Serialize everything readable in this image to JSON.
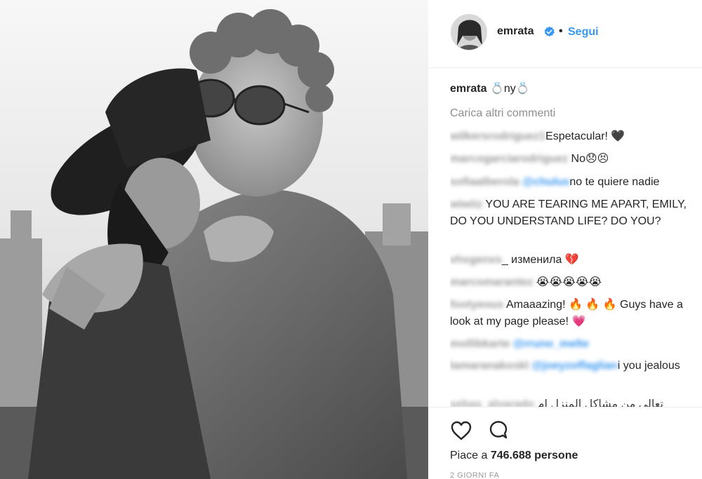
{
  "post": {
    "photo": {
      "alt": ""
    }
  },
  "header": {
    "username": "emrata",
    "separator": "•",
    "follow_label": "Segui",
    "verified_icon": "verified-badge-icon"
  },
  "caption": {
    "username": "emrata",
    "text": "💍ny💍"
  },
  "load_more_label": "Carica altri commenti",
  "comments": [
    {
      "user": "wilkersrodriguez1",
      "text": "Espetacular! 🖤"
    },
    {
      "user": "marcogarciarodriguez",
      "text": "No😞😣"
    },
    {
      "user": "sofiaalberola",
      "mention": "@chulus",
      "text": "no te quiere nadie"
    },
    {
      "user": "wiwiiz",
      "text": "YOU ARE TEARING ME APART, EMILY, DO YOU UNDERSTAND LIFE? DO YOU?"
    },
    {
      "user": "vhsgenxs",
      "text": "_ изменила 💔"
    },
    {
      "user": "marcomarantez",
      "text": "😭😭😭😭😭"
    },
    {
      "user": "footyeous",
      "text": "Amaaazing! 🔥 🔥 🔥 Guys have a look at my page please! 💗"
    },
    {
      "user": "mollibkarte",
      "mention": "@rruno_melte",
      "text": ""
    },
    {
      "user": "tamaranakoskl",
      "mention": "@joeyzoffaglian",
      "text": "i you jealous"
    },
    {
      "user": "sebas_alvarado",
      "text": "تعالي من مشاكل المنزل ام"
    }
  ],
  "actions": {
    "like_icon": "heart-icon",
    "comment_icon": "comment-icon",
    "likes_prefix": "Piace a",
    "likes_count": "746.688",
    "likes_suffix": "persone",
    "timestamp": "2 GIORNI FA"
  },
  "colors": {
    "link_blue": "#3897f0",
    "text": "#262626",
    "muted": "#8e8e8e",
    "border": "#efefef",
    "heart_red": "#e0245e"
  }
}
